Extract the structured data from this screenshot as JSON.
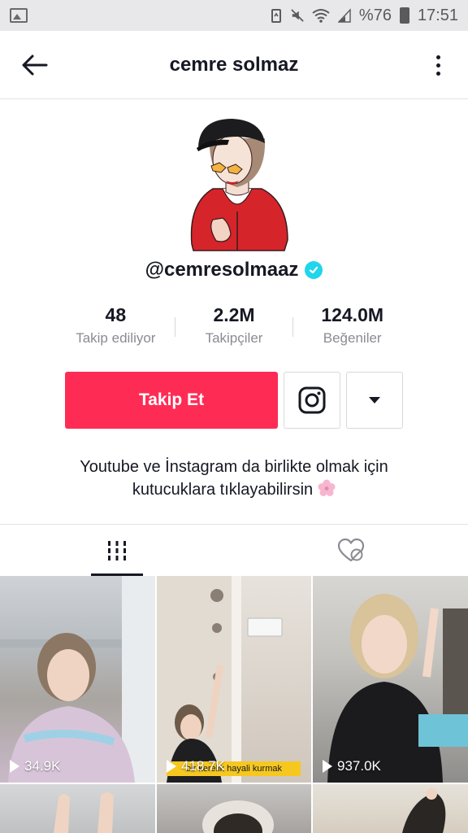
{
  "status_bar": {
    "battery": "%76",
    "time": "17:51",
    "icons": [
      "image-icon",
      "battery-saver-icon",
      "mute-icon",
      "wifi-icon",
      "signal-icon",
      "battery-icon"
    ]
  },
  "header": {
    "title": "cemre solmaz",
    "back_icon": "back-arrow-icon",
    "more_icon": "more-vertical-icon"
  },
  "profile": {
    "username": "@cemresolmaaz",
    "verified": true,
    "stats": [
      {
        "value": "48",
        "label": "Takip ediliyor"
      },
      {
        "value": "2.2M",
        "label": "Takipçiler"
      },
      {
        "value": "124.0M",
        "label": "Beğeniler"
      }
    ],
    "follow_label": "Takip Et",
    "bio_line1": "Youtube ve İnstagram da birlikte olmak için",
    "bio_line2": "kutucuklara tıklayabilirsin"
  },
  "tabs": [
    {
      "name": "videos",
      "icon": "grid-icon",
      "active": true
    },
    {
      "name": "liked",
      "icon": "heart-hidden-icon",
      "active": false
    }
  ],
  "videos": [
    {
      "views": "34.9K"
    },
    {
      "views": "418.7K",
      "caption": "bir kerelik hayali kurmak"
    },
    {
      "views": "937.0K"
    }
  ],
  "colors": {
    "accent": "#fe2c55",
    "verified": "#20d5ec",
    "text": "#161823",
    "muted": "#8a8b91"
  }
}
